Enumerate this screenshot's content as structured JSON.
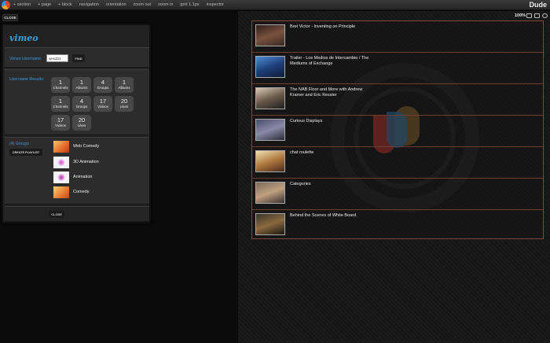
{
  "menu": [
    "+ section",
    "+ page",
    "+ block",
    "navigation",
    "orientation",
    "zoom out",
    "zoom in",
    "grid 1.1px",
    "inspector"
  ],
  "brand": "Dude",
  "close_top": "CLOSE",
  "vimeo_logo": "vimeo",
  "username": {
    "label": "Vimeo Username:",
    "value": "wes321",
    "find": "FIND"
  },
  "results": {
    "label": "Username Results:",
    "stats": [
      {
        "num": "1",
        "lbl": "Channels"
      },
      {
        "num": "1",
        "lbl": "Albums"
      },
      {
        "num": "4",
        "lbl": "Groups"
      },
      {
        "num": "1",
        "lbl": "Albums"
      },
      {
        "num": "1",
        "lbl": "Channels"
      },
      {
        "num": "4",
        "lbl": "Groups"
      },
      {
        "num": "17",
        "lbl": "Videos"
      },
      {
        "num": "20",
        "lbl": "Likes"
      },
      {
        "num": "17",
        "lbl": "Videos"
      },
      {
        "num": "20",
        "lbl": "Likes"
      }
    ]
  },
  "groups": {
    "label": "(4) Groups",
    "create_playlist": "CREATE PLAYLIST",
    "items": [
      "Web Comedy",
      "3D Animation",
      "Animation",
      "Comedy"
    ]
  },
  "close_bottom": "CLOSE",
  "zoom": "100%",
  "videos": [
    "Bret Victor - Inventing on Principle",
    "Trailer - Los Medios de Intercambio / The Mediums of Exchange",
    "The NAB Floor and More with Andrew Kramer and Eric Kessler",
    "Curious Displays",
    "chat roulette",
    "Categories",
    "Behind the Scenes of White Board"
  ]
}
